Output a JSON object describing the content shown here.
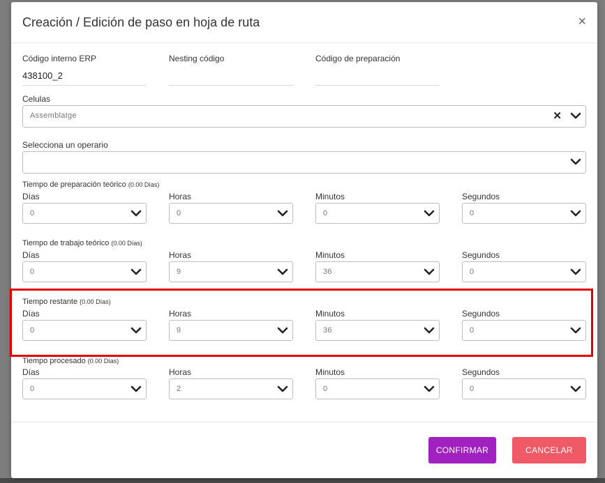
{
  "dialog": {
    "title": "Creación / Edición de paso en hoja de ruta",
    "close": "×"
  },
  "fields": {
    "erp_label": "Código interno ERP",
    "erp_value": "438100_2",
    "nesting_label": "Nesting código",
    "nesting_value": "",
    "prep_code_label": "Código de preparación",
    "prep_code_value": ""
  },
  "celulas": {
    "label": "Celulas",
    "value": "Assemblatge"
  },
  "operario": {
    "label": "Selecciona un operario",
    "value": ""
  },
  "units": {
    "dias": "Días",
    "horas": "Horas",
    "minutos": "Minutos",
    "segundos": "Segundos"
  },
  "groups": {
    "prep": {
      "title": "Tiempo de preparación teórico",
      "note": "(0.00 Días)",
      "values": [
        "0",
        "0",
        "0",
        "0"
      ]
    },
    "work": {
      "title": "Tiempo de trabajo teórico",
      "note": "(0.00 Días)",
      "values": [
        "0",
        "9",
        "36",
        "0"
      ]
    },
    "remaining": {
      "title": "Tiempo restante",
      "note": "(0.00 Días)",
      "values": [
        "0",
        "9",
        "36",
        "0"
      ]
    },
    "processed": {
      "title": "Tiempo procesado",
      "note": "(0.00 Días)",
      "values": [
        "0",
        "2",
        "0",
        "0"
      ]
    }
  },
  "buttons": {
    "confirm": "CONFIRMAR",
    "cancel": "CANCELAR"
  },
  "colors": {
    "confirm": "#a020c0",
    "cancel": "#ef5a66",
    "highlight": "#e10000"
  }
}
